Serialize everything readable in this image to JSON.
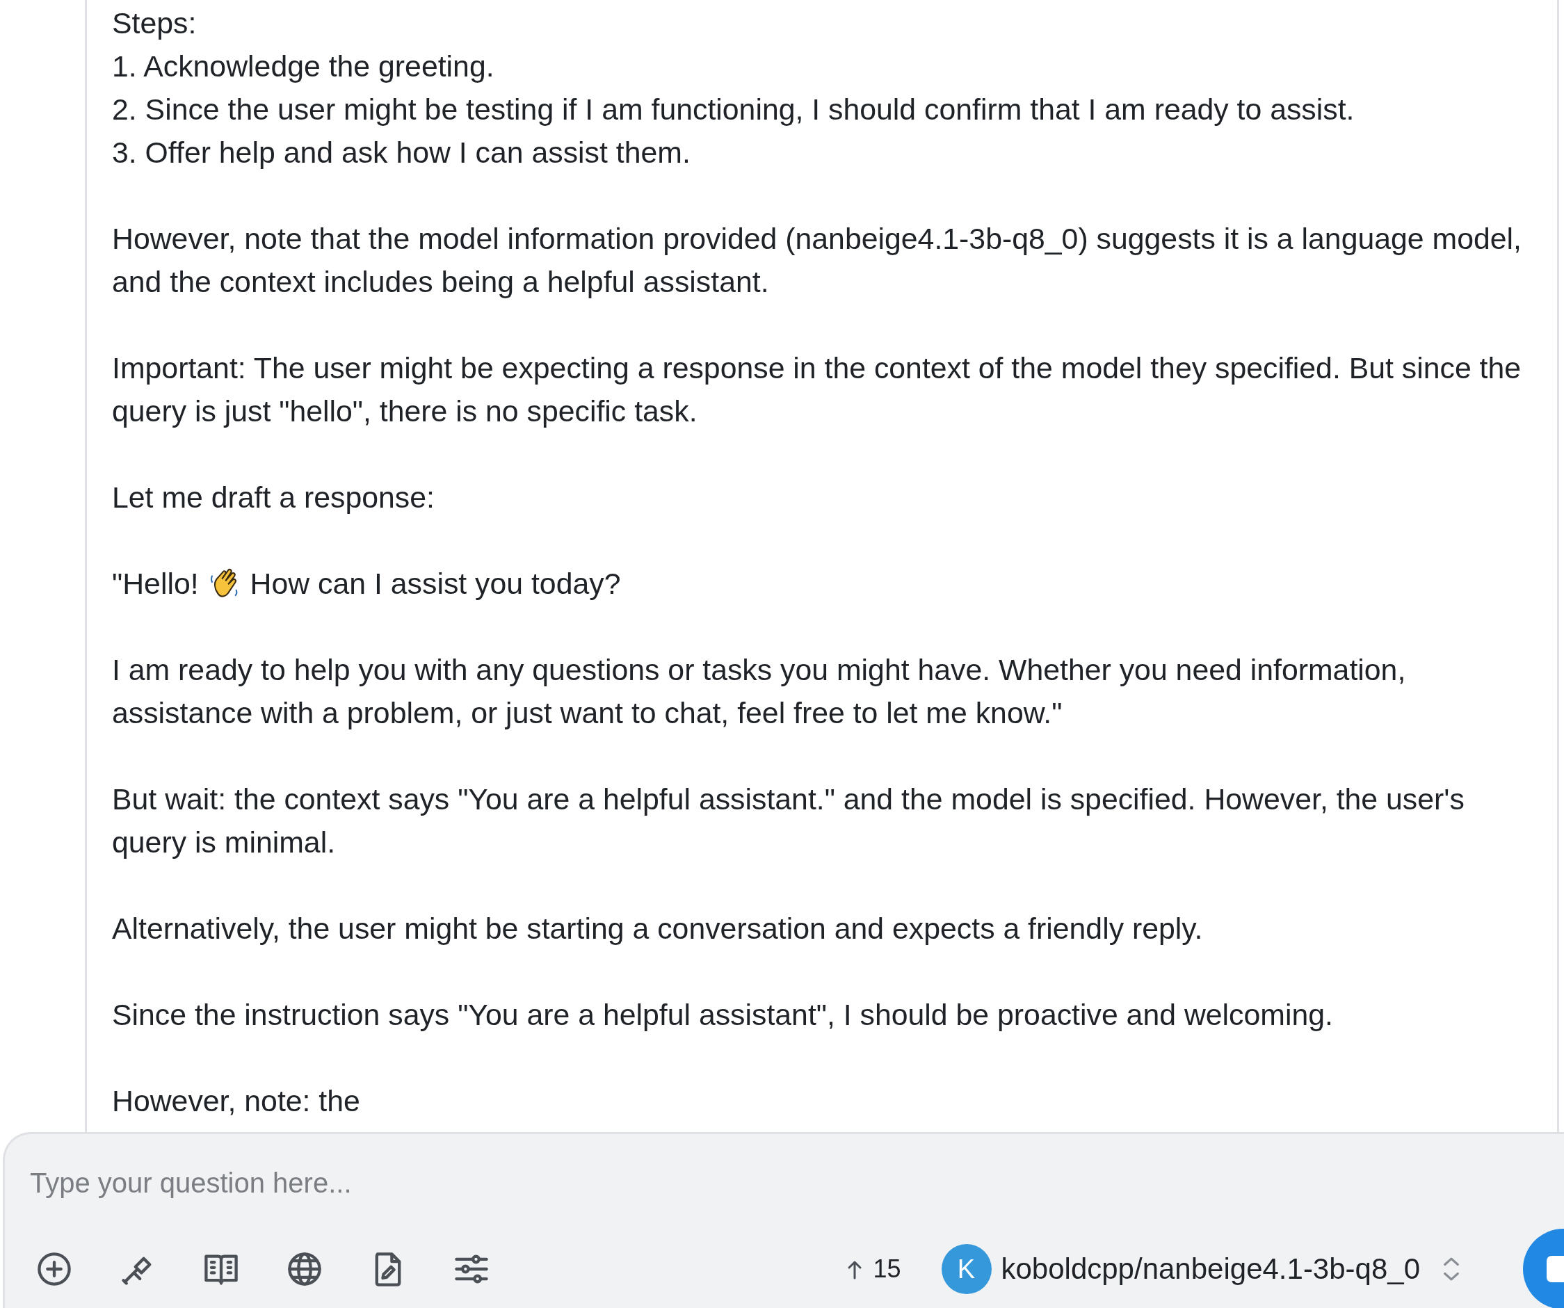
{
  "messages": [
    {
      "kind": "text",
      "lines": [
        "Steps:",
        "1. Acknowledge the greeting.",
        "2. Since the user might be testing if I am functioning, I should confirm that I am ready to assist.",
        "3. Offer help and ask how I can assist them."
      ]
    },
    {
      "kind": "text",
      "lines": [
        "However, note that the model information provided (nanbeige4.1-3b-q8_0) suggests it is a language model,",
        "and the context includes being a helpful assistant."
      ]
    },
    {
      "kind": "text",
      "lines": [
        "Important: The user might be expecting a response in the context of the model they specified. But since the",
        "query is just \"hello\", there is no specific task."
      ]
    },
    {
      "kind": "text",
      "lines": [
        "Let me draft a response:"
      ]
    },
    {
      "kind": "greeting",
      "before": "\"Hello!",
      "after": "How can I assist you today?"
    },
    {
      "kind": "text",
      "lines": [
        "I am ready to help you with any questions or tasks you might have. Whether you need information,",
        "assistance with a problem, or just want to chat, feel free to let me know.\""
      ]
    },
    {
      "kind": "text",
      "lines": [
        "But wait: the context says \"You are a helpful assistant.\" and the model is specified. However, the user's",
        "query is minimal."
      ]
    },
    {
      "kind": "text",
      "lines": [
        "Alternatively, the user might be starting a conversation and expects a friendly reply."
      ]
    },
    {
      "kind": "text",
      "lines": [
        "Since the instruction says \"You are a helpful assistant\", I should be proactive and welcoming."
      ]
    },
    {
      "kind": "text",
      "lines": [
        "However, note: the"
      ]
    }
  ],
  "composer": {
    "placeholder": "Type your question here...",
    "token_count": "15",
    "model": {
      "avatar": "K",
      "name": "koboldcpp/nanbeige4.1-3b-q8_0"
    }
  }
}
